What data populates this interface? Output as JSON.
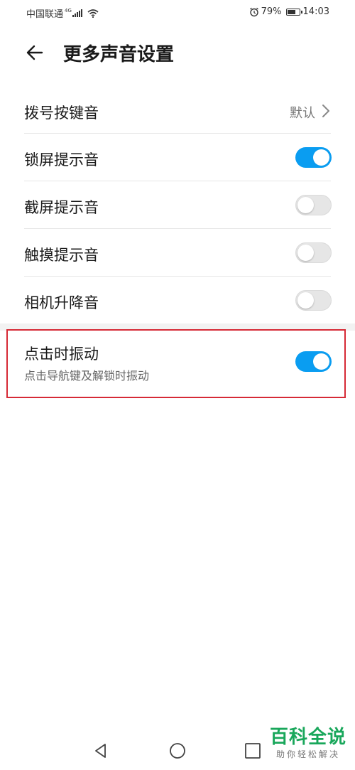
{
  "status_bar": {
    "carrier": "中国联通",
    "network": "4G",
    "battery": "79%",
    "battery_level": 0.79,
    "time": "14:03"
  },
  "header": {
    "title": "更多声音设置"
  },
  "settings": {
    "dial_tone": {
      "label": "拨号按键音",
      "value": "默认"
    },
    "lock_sound": {
      "label": "锁屏提示音",
      "enabled": true
    },
    "screenshot_sound": {
      "label": "截屏提示音",
      "enabled": false
    },
    "touch_sound": {
      "label": "触摸提示音",
      "enabled": false
    },
    "camera_lift_sound": {
      "label": "相机升降音",
      "enabled": false
    },
    "vibrate_on_tap": {
      "label": "点击时振动",
      "sublabel": "点击导航键及解锁时振动",
      "enabled": true
    }
  },
  "colors": {
    "toggle_on": "#0a9df1",
    "toggle_off": "#e6e6e6",
    "highlight_border": "#d62a36",
    "watermark_green": "#19a75b"
  },
  "icons": {
    "back": "arrow-left-icon",
    "chevron": "chevron-right-icon",
    "nav_back": "triangle-back-icon",
    "nav_home": "circle-home-icon",
    "nav_recent": "square-recent-icon"
  },
  "watermark": {
    "title": "百科全说",
    "subtitle": "助你轻松解决"
  }
}
